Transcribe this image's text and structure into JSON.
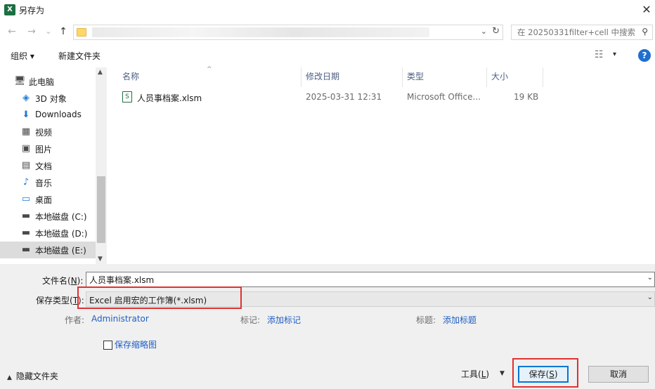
{
  "window": {
    "title": "另存为",
    "app_icon_letter": "X",
    "close_glyph": "✕"
  },
  "address": {
    "back_glyph": "←",
    "forward_glyph": "→",
    "recent_glyph": "⌄",
    "up_glyph": "↑",
    "dropdown_glyph": "⌄",
    "refresh_glyph": "↻",
    "search_placeholder": "在 20250331filter+cell 中搜索",
    "search_glyph": "⚲"
  },
  "toolbar": {
    "organize_label": "组织 ▾",
    "new_folder_label": "新建文件夹",
    "view_glyph": "☷",
    "view_dropdown_glyph": "▾",
    "help_glyph": "?"
  },
  "nav": {
    "items": [
      {
        "label": "此电脑",
        "icon": "pc-icon",
        "glyph": "🖥"
      },
      {
        "label": "3D 对象",
        "icon": "cube-icon",
        "glyph": "◈"
      },
      {
        "label": "Downloads",
        "icon": "download-icon",
        "glyph": "⬇"
      },
      {
        "label": "视频",
        "icon": "video-icon",
        "glyph": "▦"
      },
      {
        "label": "图片",
        "icon": "picture-icon",
        "glyph": "▣"
      },
      {
        "label": "文档",
        "icon": "document-icon",
        "glyph": "▤"
      },
      {
        "label": "音乐",
        "icon": "music-icon",
        "glyph": "♪"
      },
      {
        "label": "桌面",
        "icon": "desktop-icon",
        "glyph": "▭"
      },
      {
        "label": "本地磁盘 (C:)",
        "icon": "drive-icon",
        "glyph": "▬"
      },
      {
        "label": "本地磁盘 (D:)",
        "icon": "drive-icon",
        "glyph": "▬"
      },
      {
        "label": "本地磁盘 (E:)",
        "icon": "drive-icon",
        "glyph": "▬"
      }
    ],
    "selected_index": 10,
    "scroll_up": "▲",
    "scroll_down": "▼"
  },
  "filelist": {
    "columns": [
      "名称",
      "修改日期",
      "类型",
      "大小"
    ],
    "sort_glyph": "^",
    "rows": [
      {
        "name": "人员事档案.xlsm",
        "modified": "2025-03-31 12:31",
        "type": "Microsoft Office...",
        "size": "19 KB",
        "icon_letter": "S"
      }
    ]
  },
  "form": {
    "filename_label_pre": "文件名(",
    "filename_label_key": "N",
    "filename_label_post": "):",
    "filename_value": "人员事档案.xlsm",
    "filetype_label_pre": "保存类型(",
    "filetype_label_key": "T",
    "filetype_label_post": "):",
    "filetype_value": "Excel 启用宏的工作簿(*.xlsm)",
    "dropdown_glyph": "⌄",
    "authors_label": "作者:",
    "authors_value": "Administrator",
    "tags_label": "标记:",
    "tags_value": "添加标记",
    "title_label": "标题:",
    "title_value": "添加标题",
    "thumbnail_label": "保存缩略图",
    "thumbnail_checked": false
  },
  "footer": {
    "hide_folders_glyph": "▲",
    "hide_folders_label": "隐藏文件夹",
    "tools_label_pre": "工具(",
    "tools_label_key": "L",
    "tools_label_post": ")",
    "tools_dropdown_glyph": "▼",
    "save_label_pre": "保存(",
    "save_label_key": "S",
    "save_label_post": ")",
    "cancel_label": "取消"
  },
  "colors": {
    "excel_green": "#1d6f42",
    "link_blue": "#1e5fc5",
    "highlight_red": "#e03131",
    "primary_border": "#0078d7"
  }
}
